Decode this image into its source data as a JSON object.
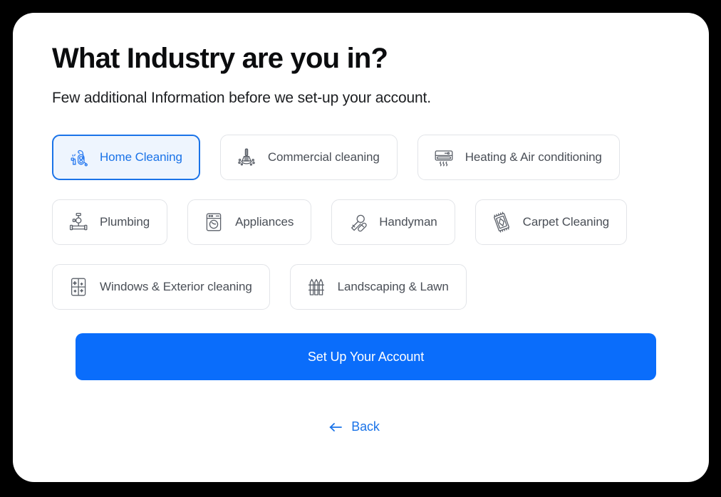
{
  "page": {
    "title": "What Industry are you in?",
    "subtitle": "Few additional Information before we set-up your account."
  },
  "theme": {
    "accent": "#1a73e8",
    "cta_background": "#0a6dfb",
    "selected_card_background": "#eef5fe",
    "selected_card_border": "#1a73e8",
    "card_border": "#e2e4e8",
    "label_color": "#4a4f57",
    "page_background": "#000000",
    "sheet_background": "#ffffff"
  },
  "industries": [
    {
      "label": "Home Cleaning",
      "icon": "vacuum-cleaner-icon",
      "selected": true
    },
    {
      "label": "Commercial cleaning",
      "icon": "broom-icon",
      "selected": false
    },
    {
      "label": "Heating & Air conditioning",
      "icon": "air-conditioner-icon",
      "selected": false
    },
    {
      "label": "Plumbing",
      "icon": "pipe-valve-icon",
      "selected": false
    },
    {
      "label": "Appliances",
      "icon": "washing-machine-icon",
      "selected": false
    },
    {
      "label": "Handyman",
      "icon": "hammer-wrench-icon",
      "selected": false
    },
    {
      "label": "Carpet Cleaning",
      "icon": "rug-icon",
      "selected": false
    },
    {
      "label": "Windows & Exterior cleaning",
      "icon": "window-icon",
      "selected": false
    },
    {
      "label": "Landscaping & Lawn",
      "icon": "fence-icon",
      "selected": false
    }
  ],
  "actions": {
    "submit_label": "Set Up Your Account",
    "back_label": "Back",
    "back_icon": "arrow-left-icon"
  }
}
